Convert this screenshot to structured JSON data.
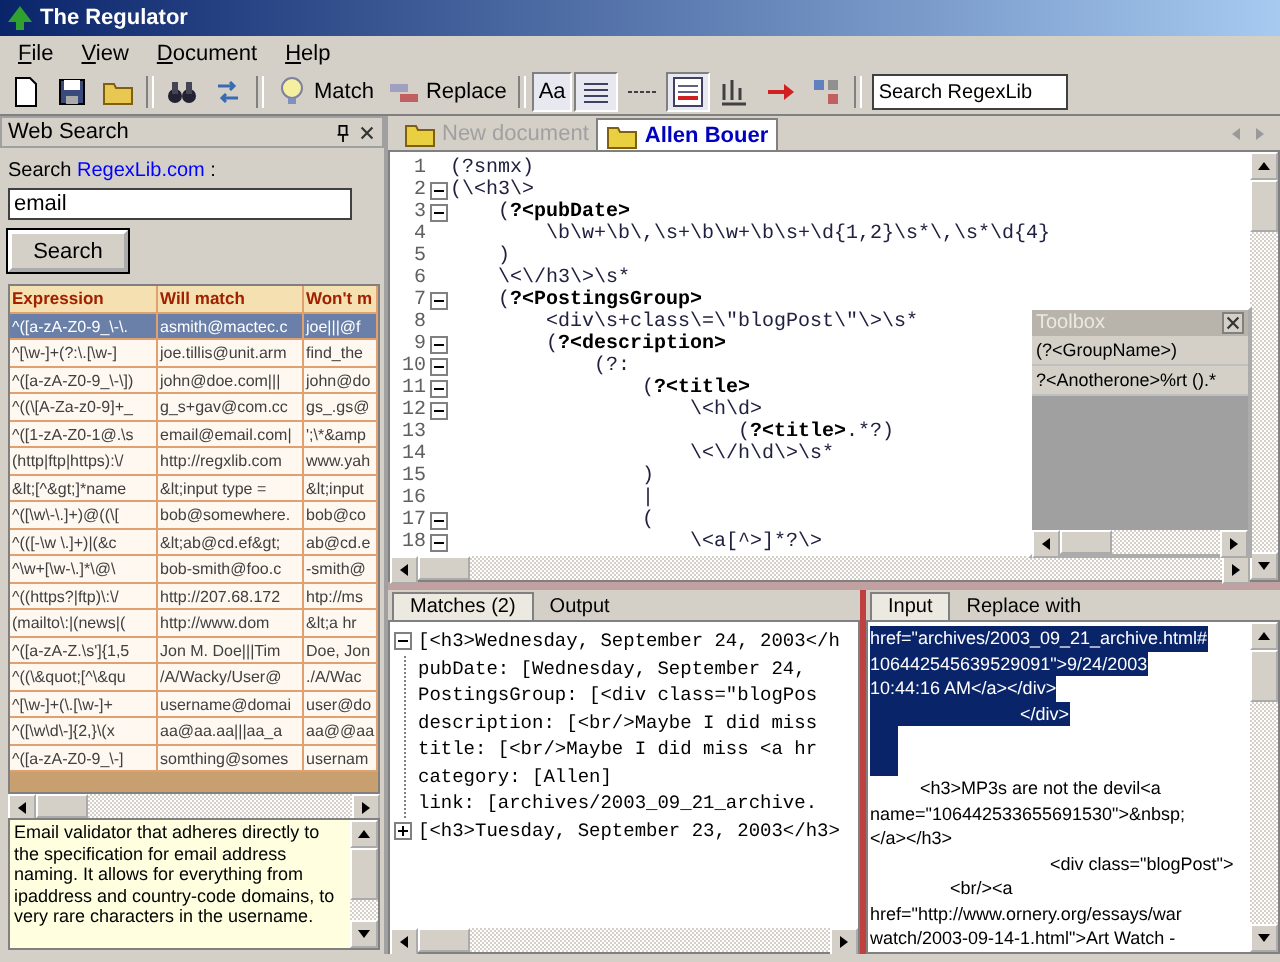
{
  "window": {
    "title": "The Regulator"
  },
  "menu": [
    "File",
    "View",
    "Document",
    "Help"
  ],
  "toolbar": {
    "items": [
      {
        "kind": "icon"
      },
      {
        "kind": "icon"
      },
      {
        "kind": "icon"
      },
      {
        "kind": "separator"
      },
      {
        "kind": "icon"
      },
      {
        "kind": "icon"
      },
      {
        "kind": "separator"
      },
      {
        "kind": "icon",
        "label": "Match"
      },
      {
        "kind": "icon",
        "label": "Replace"
      },
      {
        "kind": "separator"
      },
      {
        "kind": "toggle",
        "label": "Aa",
        "pressed": true
      },
      {
        "kind": "toggle",
        "pressed": true
      },
      {
        "kind": "toggle",
        "pressed": false
      },
      {
        "kind": "toggle",
        "pressed": true
      },
      {
        "kind": "icon"
      },
      {
        "kind": "icon"
      },
      {
        "kind": "icon"
      },
      {
        "kind": "separator"
      }
    ],
    "search": {
      "value": "Search RegexLib"
    }
  },
  "web_search": {
    "title": "Web Search",
    "search_label": "Search",
    "link": "RegexLib.com",
    "link_suffix": ":",
    "query": "email",
    "button": "Search",
    "table": {
      "columns": [
        "Expression",
        "Will match",
        "Won't m"
      ],
      "rows": [
        {
          "cells": [
            "^([a-zA-Z0-9_\\-\\.",
            "asmith@mactec.c",
            "joe|||@f"
          ],
          "selected": true
        },
        {
          "cells": [
            "^[\\w-]+(?:\\.[\\w-]",
            "joe.tillis@unit.arm",
            "find_the"
          ],
          "selected": false
        },
        {
          "cells": [
            "^([a-zA-Z0-9_\\-\\])",
            "john@doe.com|||",
            "john@do"
          ],
          "selected": false
        },
        {
          "cells": [
            "^((\\[A-Za-z0-9]+_",
            "g_s+gav@com.cc",
            "gs_.gs@"
          ],
          "selected": false
        },
        {
          "cells": [
            "^([1-zA-Z0-1@.\\s",
            "email@email.com|",
            "';\\*&amp"
          ],
          "selected": false
        },
        {
          "cells": [
            "(http|ftp|https):\\/",
            "http://regxlib.com",
            "www.yah"
          ],
          "selected": false
        },
        {
          "cells": [
            "&lt;[^&gt;]*name",
            "&lt;input type =",
            "&lt;input"
          ],
          "selected": false
        },
        {
          "cells": [
            "^([\\w\\-\\.]+)@((\\[",
            "bob@somewhere.",
            "bob@co"
          ],
          "selected": false
        },
        {
          "cells": [
            "^(([-\\w \\.]+)|(&c",
            "&lt;ab@cd.ef&gt;",
            "ab@cd.e"
          ],
          "selected": false
        },
        {
          "cells": [
            "^\\w+[\\w-\\.]*\\@\\",
            "bob-smith@foo.c",
            "-smith@"
          ],
          "selected": false
        },
        {
          "cells": [
            "^((https?|ftp)\\:\\/",
            "http://207.68.172",
            "htp://ms"
          ],
          "selected": false
        },
        {
          "cells": [
            "(mailto\\:|(news|(",
            "http://www.dom",
            "&lt;a hr"
          ],
          "selected": false
        },
        {
          "cells": [
            "^([a-zA-Z.\\s']{1,5",
            "Jon M. Doe|||Tim",
            "Doe, Jon"
          ],
          "selected": false
        },
        {
          "cells": [
            "^((\\&quot;[^\\&qu",
            "/A/Wacky/User@",
            "./A/Wac"
          ],
          "selected": false
        },
        {
          "cells": [
            "^[\\w-]+(\\.[\\w-]+",
            "username@domai",
            "user@do"
          ],
          "selected": false
        },
        {
          "cells": [
            "^([\\w\\d\\-]{2,}\\(x",
            "aa@aa.aa|||aa_a",
            "aa@@aa"
          ],
          "selected": false
        },
        {
          "cells": [
            "^([a-zA-Z0-9_\\-]",
            "somthing@somes",
            "usernam"
          ],
          "selected": false
        }
      ]
    },
    "description": "Email validator that adheres directly to the specification for email address naming. It allows for everything from ipaddress and country-code domains, to very rare characters in the username."
  },
  "editor": {
    "tabs": [
      {
        "label": "New document",
        "selected": false
      },
      {
        "label": "Allen Bouer",
        "selected": true
      }
    ],
    "lines": [
      {
        "number": "1",
        "fold": false,
        "parts": [
          {
            "text": "(?snmx)",
            "bold": false
          }
        ]
      },
      {
        "number": "2",
        "fold": true,
        "parts": [
          {
            "text": "(\\<h3\\>",
            "bold": false
          }
        ]
      },
      {
        "number": "3",
        "fold": true,
        "parts": [
          {
            "text": "    (",
            "bold": false
          },
          {
            "text": "?<pubDate>",
            "bold": true
          }
        ]
      },
      {
        "number": "4",
        "fold": false,
        "parts": [
          {
            "text": "        \\b\\w+\\b\\,\\s+\\b\\w+\\b\\s+\\d{1,2}\\s*\\,\\s*\\d{4}",
            "bold": false
          }
        ]
      },
      {
        "number": "5",
        "fold": false,
        "parts": [
          {
            "text": "    )",
            "bold": false
          }
        ]
      },
      {
        "number": "6",
        "fold": false,
        "parts": [
          {
            "text": "    \\<\\/h3\\>\\s*",
            "bold": false
          }
        ]
      },
      {
        "number": "7",
        "fold": true,
        "parts": [
          {
            "text": "    (",
            "bold": false
          },
          {
            "text": "?<PostingsGroup>",
            "bold": true
          }
        ]
      },
      {
        "number": "8",
        "fold": false,
        "parts": [
          {
            "text": "        <div\\s+class\\=\\\"blogPost\\\"\\>\\s*",
            "bold": false
          }
        ]
      },
      {
        "number": "9",
        "fold": true,
        "parts": [
          {
            "text": "        (",
            "bold": false
          },
          {
            "text": "?<description>",
            "bold": true
          }
        ]
      },
      {
        "number": "10",
        "fold": true,
        "parts": [
          {
            "text": "            (?:",
            "bold": false
          }
        ]
      },
      {
        "number": "11",
        "fold": true,
        "parts": [
          {
            "text": "                (",
            "bold": false
          },
          {
            "text": "?<title>",
            "bold": true
          }
        ]
      },
      {
        "number": "12",
        "fold": true,
        "parts": [
          {
            "text": "                    \\<h\\d>",
            "bold": false
          }
        ]
      },
      {
        "number": "13",
        "fold": false,
        "parts": [
          {
            "text": "                        (",
            "bold": false
          },
          {
            "text": "?<title>",
            "bold": true
          },
          {
            "text": ".*?)",
            "bold": false
          }
        ]
      },
      {
        "number": "14",
        "fold": false,
        "parts": [
          {
            "text": "                    \\<\\/h\\d\\>\\s*",
            "bold": false
          }
        ]
      },
      {
        "number": "15",
        "fold": false,
        "parts": [
          {
            "text": "                )",
            "bold": false
          }
        ]
      },
      {
        "number": "16",
        "fold": false,
        "parts": [
          {
            "text": "                |",
            "bold": false
          }
        ]
      },
      {
        "number": "17",
        "fold": true,
        "parts": [
          {
            "text": "                (",
            "bold": false
          }
        ]
      },
      {
        "number": "18",
        "fold": true,
        "parts": [
          {
            "text": "                    \\<a[^>]*?\\>",
            "bold": false
          }
        ]
      }
    ]
  },
  "toolbox": {
    "title": "Toolbox",
    "items": [
      "(?<GroupName>)",
      "?<Anotherone>%rt ().*"
    ]
  },
  "matches": {
    "tabs": [
      {
        "label": "Matches (2)",
        "selected": true
      },
      {
        "label": "Output",
        "selected": false
      }
    ],
    "tree": [
      {
        "text": "[<h3>Wednesday, September 24, 2003</h",
        "expanded": true,
        "children": [
          {
            "text": "pubDate: [Wednesday, September 24,"
          },
          {
            "text": "PostingsGroup: [<div class=\"blogPos"
          },
          {
            "text": "description: [<br/>Maybe I did miss"
          },
          {
            "text": "title: [<br/>Maybe I did miss <a hr"
          },
          {
            "text": "category: [Allen]"
          },
          {
            "text": "link: [archives/2003_09_21_archive."
          }
        ]
      },
      {
        "text": "[<h3>Tuesday, September 23, 2003</h3>",
        "expanded": false
      }
    ]
  },
  "input": {
    "tabs": [
      {
        "label": "Input",
        "selected": true
      },
      {
        "label": "Replace with",
        "selected": false
      }
    ],
    "lines": [
      {
        "text": "href=\"archives/2003_09_21_archive.html#",
        "selected": true
      },
      {
        "text": "106442545639529091\">9/24/2003",
        "selected": true
      },
      {
        "text": "10:44:16 AM</a></div>",
        "selected": true
      },
      {
        "text": "                              </div>",
        "selected": true
      },
      {
        "selected": true
      },
      {
        "selected": true
      },
      {
        "text": "          <h3>MP3s are not the devil<a",
        "selected": false
      },
      {
        "text": "name=\"106442533655691530\">&nbsp;",
        "selected": false
      },
      {
        "text": "</a></h3>",
        "selected": false
      },
      {
        "text": "                                    <div class=\"blogPost\">",
        "selected": false
      },
      {
        "text": "                <br/><a",
        "selected": false
      },
      {
        "text": "href=\"http://www.ornery.org/essays/war",
        "selected": false
      },
      {
        "text": "watch/2003-09-14-1.html\">Art Watch -",
        "selected": false
      }
    ]
  }
}
